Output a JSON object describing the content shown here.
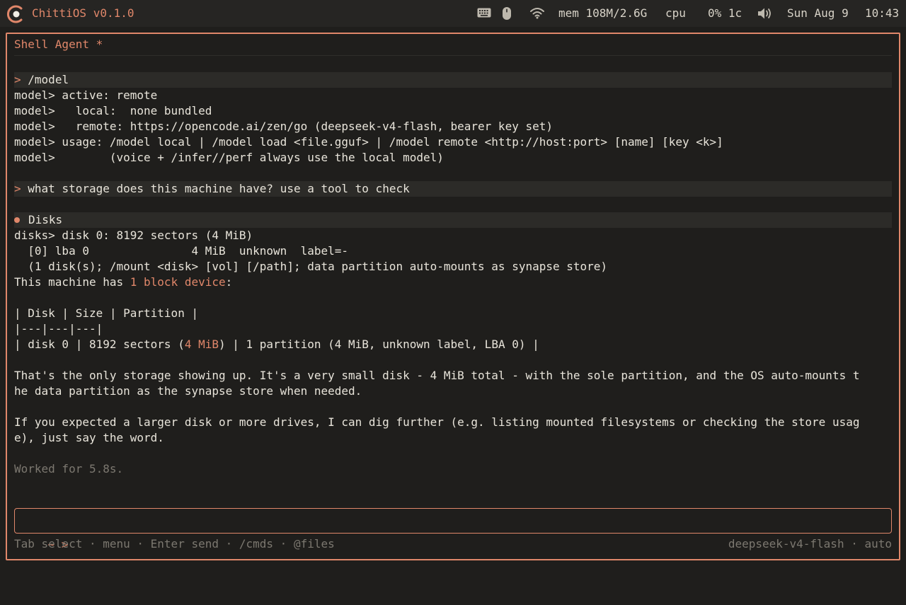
{
  "topbar": {
    "os_title": "ChittiOS v0.1.0",
    "icons": [
      "keyboard-icon",
      "mouse-icon",
      "wifi-icon",
      "volume-icon"
    ],
    "mem": "mem 108M/2.6G",
    "cpu_label": "cpu",
    "cpu_value": "0% 1c",
    "date": "Sun Aug 9",
    "time": "10:43"
  },
  "window": {
    "title": "Shell Agent *"
  },
  "log": {
    "cmd1_prompt": ">",
    "cmd1": "/model",
    "model_l1": "model> active: remote",
    "model_l2": "model>   local:  none bundled",
    "model_l3": "model>   remote: https://opencode.ai/zen/go (deepseek-v4-flash, bearer key set)",
    "model_l4": "model> usage: /model local | /model load <file.gguf> | /model remote <http://host:port> [name] [key <k>]",
    "model_l5": "model>        (voice + /infer//perf always use the local model)",
    "cmd2_prompt": ">",
    "cmd2": "what storage does this machine have? use a tool to check",
    "tool_name": "Disks",
    "disks_l1": "disks> disk 0: 8192 sectors (4 MiB)",
    "disks_l2": "  [0] lba 0               4 MiB  unknown  label=-",
    "disks_l3": "  (1 disk(s); /mount <disk> [vol] [/path]; data partition auto-mounts as synapse store)",
    "answer_pre": "This machine has ",
    "answer_hl": "1 block device",
    "answer_post": ":",
    "table_header": "| Disk | Size | Partition |",
    "table_sep": "|---|---|---|",
    "table_row_pre": "| disk 0 | 8192 sectors (",
    "table_row_hl": "4 MiB",
    "table_row_post": ") | 1 partition (4 MiB, unknown label, LBA 0) |",
    "para1_l1": "That's the only storage showing up. It's a very small disk - 4 MiB total - with the sole partition, and the OS auto-mounts t",
    "para1_l2": "he data partition as the synapse store when needed.",
    "para2_l1": "If you expected a larger disk or more drives, I can dig further (e.g. listing mounted filesystems or checking the store usag",
    "para2_l2": "e), just say the word.",
    "worked": "Worked for 5.8s."
  },
  "input": {
    "prompt": "~ >",
    "value": ""
  },
  "footer": {
    "hints": "Tab select · menu · Enter send · /cmds · @files",
    "model": "deepseek-v4-flash · auto"
  },
  "colors": {
    "accent": "#e0876a",
    "background": "#1f1e1c",
    "text": "#e8e4da",
    "dim": "#7c7870"
  }
}
